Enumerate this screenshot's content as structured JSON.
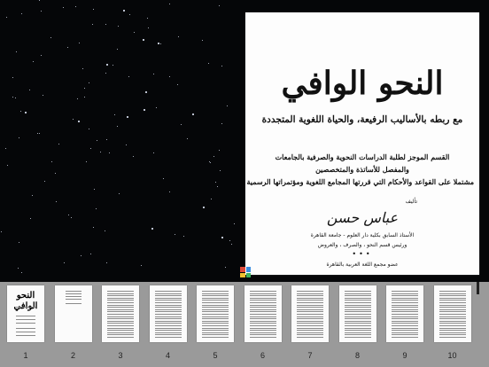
{
  "document": {
    "title": "النحو الوافي",
    "subtitle": "مع ربطه بالأساليب الرفيعة، والحياة اللغوية المتجددة",
    "description_lines": [
      "القسم الموجز لطلبة الدراسات النحوية والصرفية بالجامعات",
      "والمفصل للأساتذة والمتخصصين",
      "مشتملا على القواعد والأحكام التي قررتها المجامع اللغوية ومؤتمراتها الرسمية"
    ],
    "by_label": "تأليف",
    "author": "عباس حسن",
    "author_info": [
      "الأستاذ السابق بكلية دار العلوم - جامعة القاهرة",
      "ورئيس قسم النحو ، والصرف ، والعروض"
    ],
    "dots": "•••",
    "membership": "عضو مجمع اللغة العربية بالقاهرة"
  },
  "thumbnails": [
    {
      "number": "1",
      "selected": true
    },
    {
      "number": "2"
    },
    {
      "number": "3"
    },
    {
      "number": "4"
    },
    {
      "number": "5"
    },
    {
      "number": "6"
    },
    {
      "number": "7"
    },
    {
      "number": "8"
    },
    {
      "number": "9"
    },
    {
      "number": "10"
    }
  ],
  "icon": "page-grid-icon",
  "colors": {
    "background": "#050608",
    "strip": "#9a9a9a",
    "page": "#fdfdfd"
  }
}
